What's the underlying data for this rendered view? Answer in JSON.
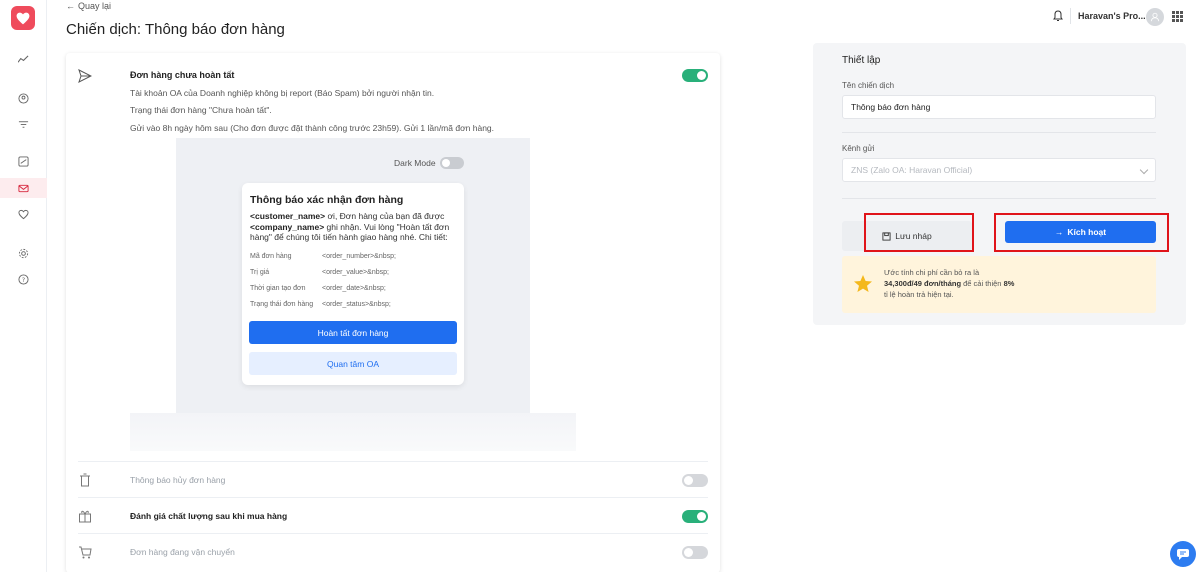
{
  "header": {
    "back_label": "Quay lại",
    "title": "Chiến dịch: Thông báo đơn hàng",
    "user_name": "Haravan's Pro..."
  },
  "campaign": {
    "title": "Đơn hàng chưa hoàn tất",
    "lines": [
      "Tài khoản OA của Doanh nghiệp không bị report (Báo Spam) bởi người nhận tin.",
      "Trạng thái đơn hàng \"Chưa hoàn tất\".",
      "Gửi vào 8h ngày hôm sau (Cho đơn được đặt thành công trước 23h59). Gửi 1 lần/mã đơn hàng."
    ],
    "enabled": true
  },
  "preview": {
    "dark_mode_label": "Dark Mode",
    "message_title": "Thông báo xác nhận đơn hàng",
    "body_customer": "<customer_name>",
    "body_part1": " ơi, Đơn hàng của bạn đã được ",
    "body_company": "<company_name>",
    "body_part2": " ghi nhận. Vui lòng \"Hoàn tất đơn hàng\" để chúng tôi tiến hành giao hàng nhé. Chi tiết:",
    "rows": [
      {
        "key": "Mã đơn hàng",
        "value": "<order_number>&nbsp;"
      },
      {
        "key": "Trị giá",
        "value": "<order_value>&nbsp;"
      },
      {
        "key": "Thời gian tạo đơn",
        "value": "<order_date>&nbsp;"
      },
      {
        "key": "Trạng thái đơn hàng",
        "value": "<order_status>&nbsp;"
      }
    ],
    "primary_button": "Hoàn tất đơn hàng",
    "secondary_button": "Quan tâm OA"
  },
  "other_campaigns": [
    {
      "label": "Thông báo hủy đơn hàng",
      "enabled": false
    },
    {
      "label": "Đánh giá chất lượng sau khi mua hàng",
      "enabled": true
    },
    {
      "label": "Đơn hàng đang vận chuyển",
      "enabled": false
    }
  ],
  "settings": {
    "title": "Thiết lập",
    "name_label": "Tên chiến dịch",
    "name_value": "Thông báo đơn hàng",
    "channel_label": "Kênh gửi",
    "channel_value": "ZNS (Zalo OA: Haravan Official)",
    "draft_button": "Lưu nháp",
    "activate_button": "Kích hoạt",
    "info_line1": "Ước tính chi phí cần bỏ ra là",
    "info_cost": "34,300đ/49 đơn/tháng",
    "info_mid": " để cải thiện ",
    "info_percent": "8%",
    "info_line3": "tỉ lệ hoàn trả hiện tại."
  },
  "colors": {
    "brand": "#ef4b5c",
    "primary": "#1f6ef0",
    "toggle_on": "#29b07a",
    "highlight": "#e0141a"
  }
}
